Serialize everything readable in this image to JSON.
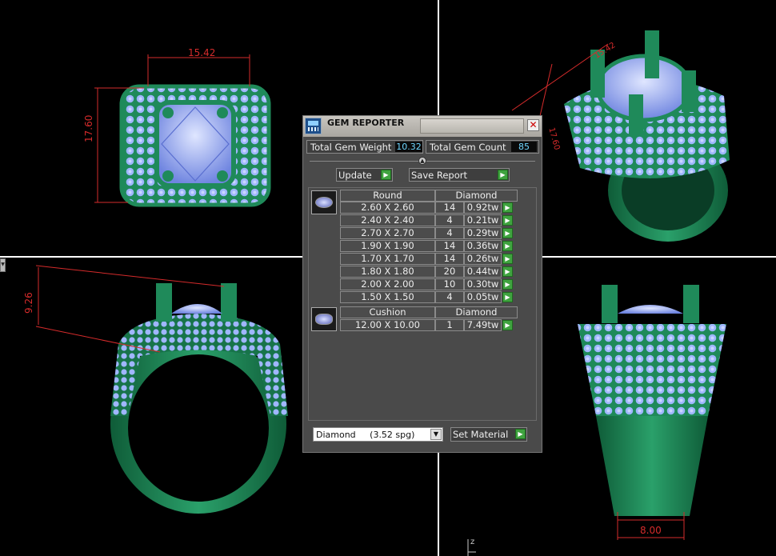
{
  "dialog": {
    "title": "GEM REPORTER",
    "close_symbol": "✕",
    "total_weight_label": "Total Gem Weight",
    "total_weight_value": "10.32",
    "total_count_label": "Total Gem Count",
    "total_count_value": "85",
    "update_label": "Update",
    "save_report_label": "Save Report",
    "arrow_symbol": "▶"
  },
  "groups": [
    {
      "shape": "Round",
      "material": "Diamond",
      "icon": "round-gem-icon",
      "rows": [
        {
          "size": "2.60 X 2.60",
          "count": "14",
          "weight": "0.92tw"
        },
        {
          "size": "2.40 X 2.40",
          "count": "4",
          "weight": "0.21tw"
        },
        {
          "size": "2.70 X 2.70",
          "count": "4",
          "weight": "0.29tw"
        },
        {
          "size": "1.90 X 1.90",
          "count": "14",
          "weight": "0.36tw"
        },
        {
          "size": "1.70 X 1.70",
          "count": "14",
          "weight": "0.26tw"
        },
        {
          "size": "1.80 X 1.80",
          "count": "20",
          "weight": "0.44tw"
        },
        {
          "size": "2.00 X 2.00",
          "count": "10",
          "weight": "0.30tw"
        },
        {
          "size": "1.50 X 1.50",
          "count": "4",
          "weight": "0.05tw"
        }
      ]
    },
    {
      "shape": "Cushion",
      "material": "Diamond",
      "icon": "cushion-gem-icon",
      "rows": [
        {
          "size": "12.00 X 10.00",
          "count": "1",
          "weight": "7.49tw"
        }
      ]
    }
  ],
  "material_select": {
    "value": "Diamond     (3.52 spg)",
    "options": [
      "Diamond     (3.52 spg)"
    ]
  },
  "set_material_label": "Set Material",
  "dimensions": {
    "top_width": "15.42",
    "top_height": "17.60",
    "side_height": "9.26",
    "front_width": "8.00",
    "persp_label_a": "15.42",
    "persp_label_b": "17.60"
  },
  "axis_label": "z",
  "colors": {
    "metal": "#1f8a5a",
    "gem": "#9fb6ff",
    "dimension": "#d52b2b",
    "viewport_divider": "#ffffff",
    "button_green": "#3fa33f"
  }
}
